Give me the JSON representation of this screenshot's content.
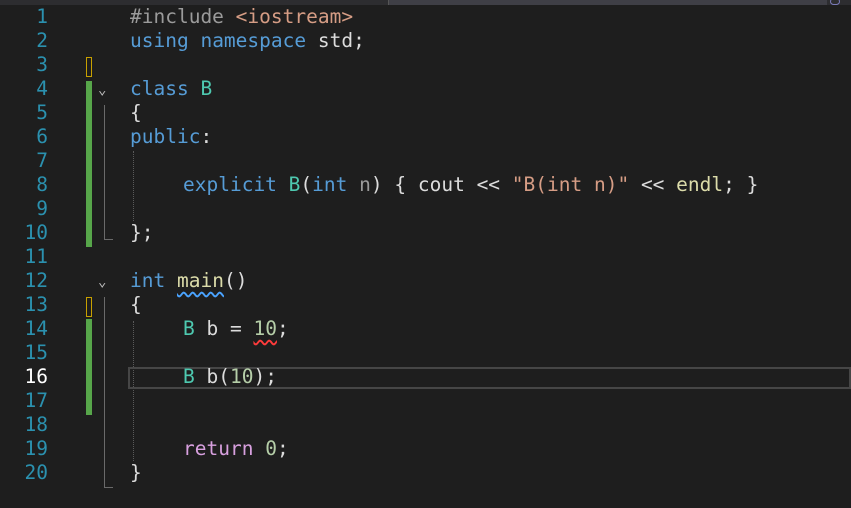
{
  "editor": {
    "language": "C++",
    "current_line": "16",
    "lines": [
      {
        "n": "1"
      },
      {
        "n": "2"
      },
      {
        "n": "3"
      },
      {
        "n": "4"
      },
      {
        "n": "5"
      },
      {
        "n": "6"
      },
      {
        "n": "7"
      },
      {
        "n": "8"
      },
      {
        "n": "9"
      },
      {
        "n": "10"
      },
      {
        "n": "11"
      },
      {
        "n": "12"
      },
      {
        "n": "13"
      },
      {
        "n": "14"
      },
      {
        "n": "15"
      },
      {
        "n": "16"
      },
      {
        "n": "17"
      },
      {
        "n": "18"
      },
      {
        "n": "19"
      },
      {
        "n": "20"
      }
    ],
    "tokens": {
      "l1_pre": "#include",
      "l1_inc": "<iostream>",
      "l2_kw1": "using",
      "l2_kw2": "namespace",
      "l2_rest": "std;",
      "l4_kw": "class",
      "l4_ty": "B",
      "l5": "{",
      "l6_kw": "public",
      "l6_colon": ":",
      "l8_kw": "explicit",
      "l8_ty": "B",
      "l8_p1": "(",
      "l8_int": "int",
      "l8_param": "n",
      "l8_p2": ") { cout << ",
      "l8_str": "\"B(int n)\"",
      "l8_p3": " << ",
      "l8_endl": "endl",
      "l8_p4": "; }",
      "l10": "};",
      "l12_kw": "int",
      "l12_fn": "main",
      "l12_p": "()",
      "l13": "{",
      "l14_ty": "B",
      "l14_var": " b = ",
      "l14_num": "10",
      "l14_end": ";",
      "l16_ty": "B",
      "l16_var": " b(",
      "l16_num": "10",
      "l16_end": ");",
      "l19_kw": "return",
      "l19_num": "0",
      "l19_end": ";",
      "l20": "}"
    }
  }
}
